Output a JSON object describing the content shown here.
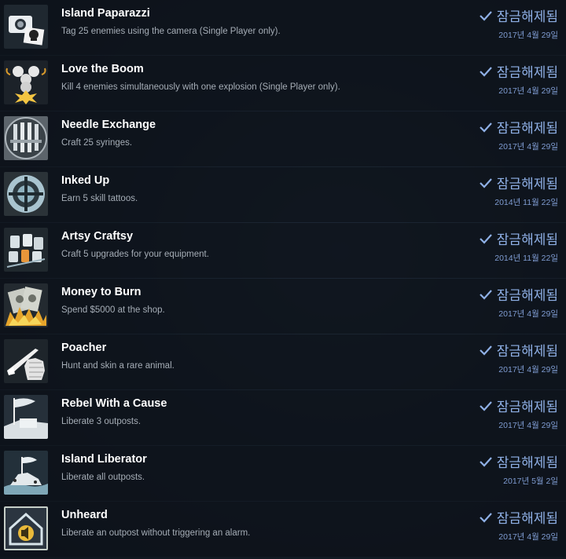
{
  "status_label": "잠금해제됨",
  "achievements": [
    {
      "icon": "camera-skull-icon",
      "title": "Island Paparazzi",
      "description": "Tag 25 enemies using the camera (Single Player only).",
      "date": "2017년 4월 29일"
    },
    {
      "icon": "skull-explosion-icon",
      "title": "Love the Boom",
      "description": "Kill 4 enemies simultaneously with one explosion (Single Player only).",
      "date": "2017년 4월 29일"
    },
    {
      "icon": "syringes-icon",
      "title": "Needle Exchange",
      "description": "Craft 25 syringes.",
      "date": "2017년 4월 29일"
    },
    {
      "icon": "crosshair-tattoo-icon",
      "title": "Inked Up",
      "description": "Earn 5 skill tattoos.",
      "date": "2014년 11월 22일"
    },
    {
      "icon": "thread-spools-icon",
      "title": "Artsy Craftsy",
      "description": "Craft 5 upgrades for your equipment.",
      "date": "2014년 11월 22일"
    },
    {
      "icon": "burning-money-icon",
      "title": "Money to Burn",
      "description": "Spend $5000 at the shop.",
      "date": "2017년 4월 29일"
    },
    {
      "icon": "rifle-pelt-icon",
      "title": "Poacher",
      "description": "Hunt and skin a rare animal.",
      "date": "2017년 4월 29일"
    },
    {
      "icon": "flag-outpost-icon",
      "title": "Rebel With a Cause",
      "description": "Liberate 3 outposts.",
      "date": "2017년 4월 29일"
    },
    {
      "icon": "island-flag-icon",
      "title": "Island Liberator",
      "description": "Liberate all outposts.",
      "date": "2017년 5월 2일"
    },
    {
      "icon": "muted-alarm-house-icon",
      "title": "Unheard",
      "description": "Liberate an outpost without triggering an alarm.",
      "date": "2017년 4월 29일"
    }
  ]
}
